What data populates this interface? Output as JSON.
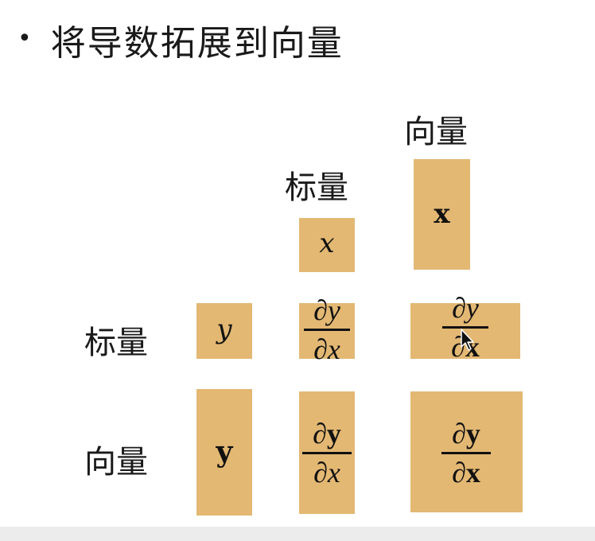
{
  "slide": {
    "title": "将导数拓展到向量",
    "col_labels": {
      "scalar": "标量",
      "vector": "向量"
    },
    "row_labels": {
      "scalar": "标量",
      "vector": "向量"
    },
    "cells": {
      "col_scalar_header": "x",
      "col_vector_header": "x",
      "row_scalar_header": "y",
      "row_vector_header": "y",
      "ss": {
        "num_d": "∂",
        "num_v": "y",
        "den_d": "∂",
        "den_v": "x"
      },
      "sv": {
        "num_d": "∂",
        "num_v": "y",
        "den_d": "∂",
        "den_v": "x"
      },
      "vs": {
        "num_d": "∂",
        "num_v": "y",
        "den_d": "∂",
        "den_v": "x"
      },
      "vv": {
        "num_d": "∂",
        "num_v": "y",
        "den_d": "∂",
        "den_v": "x"
      }
    },
    "colors": {
      "box": "#e3b873",
      "text": "#111111"
    }
  }
}
